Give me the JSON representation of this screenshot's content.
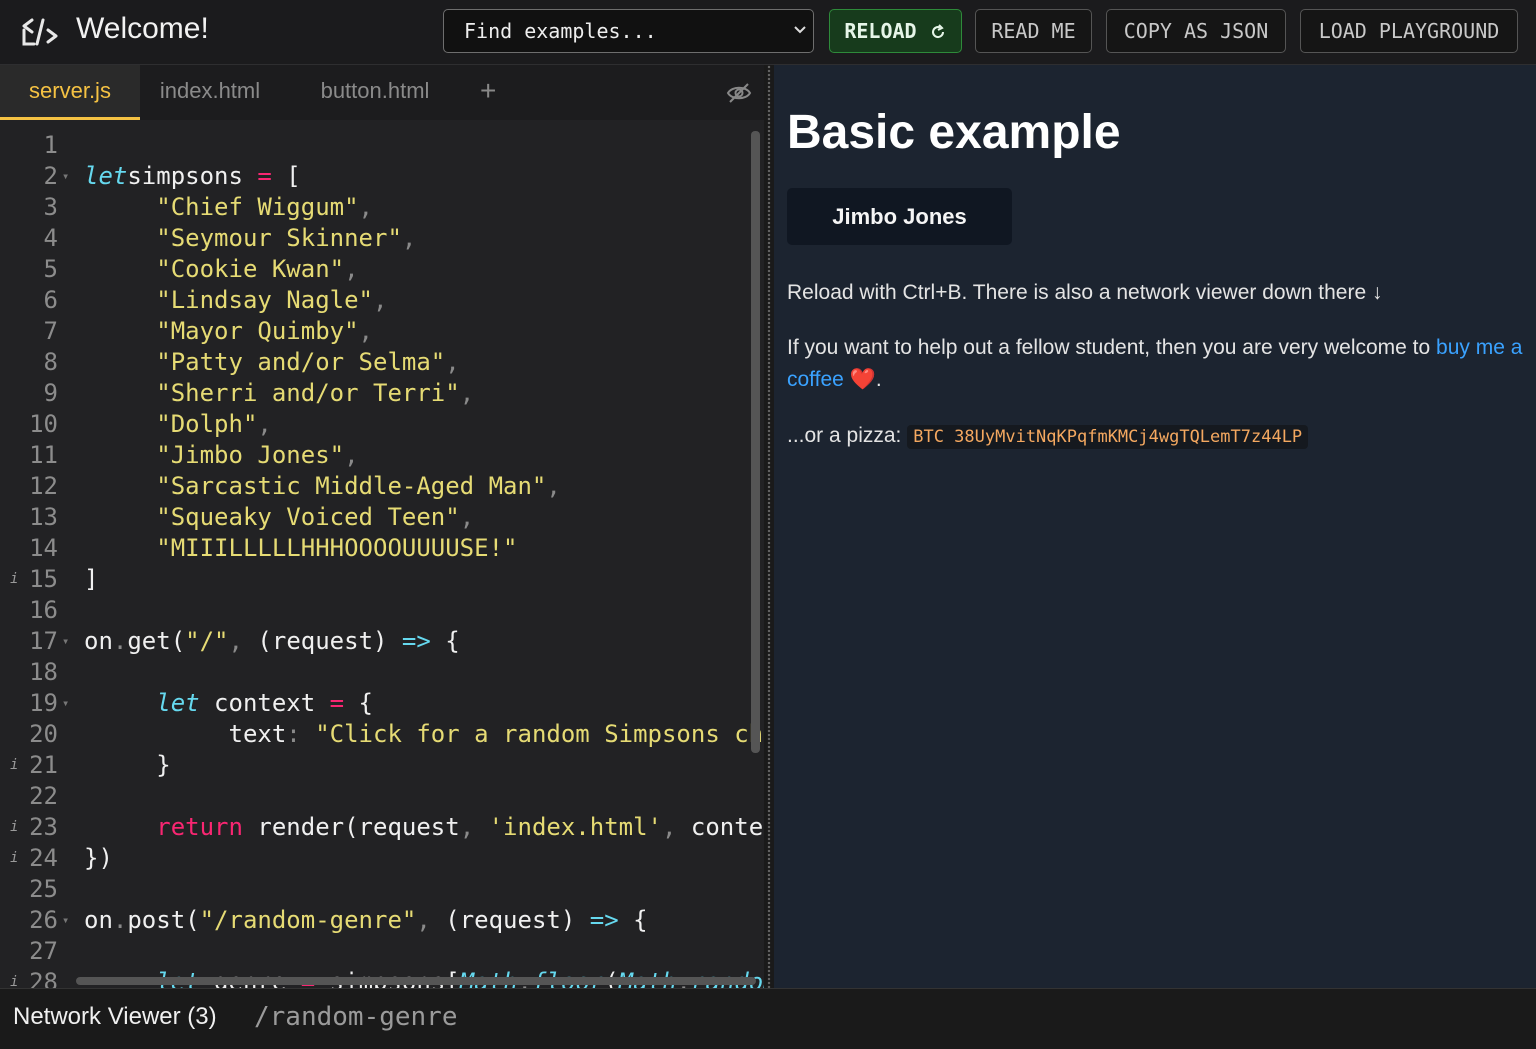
{
  "header": {
    "title": "Welcome!",
    "find_examples": "Find examples...",
    "reload": "RELOAD",
    "read_me": "READ ME",
    "copy_json": "COPY AS JSON",
    "load_playground": "LOAD PLAYGROUND"
  },
  "editor": {
    "tabs": [
      "server.js",
      "index.html",
      "button.html"
    ],
    "add_tab": "+",
    "lines": [
      {
        "n": "1",
        "tokens": []
      },
      {
        "n": "2",
        "fold": true,
        "tokens": [
          [
            "kw",
            "let"
          ],
          [
            "",
            "simpsons "
          ],
          [
            "op",
            "="
          ],
          [
            "",
            " ["
          ]
        ]
      },
      {
        "n": "3",
        "tokens": [
          [
            "",
            "     "
          ],
          [
            "str",
            "\"Chief Wiggum\""
          ],
          [
            "pn",
            ","
          ]
        ]
      },
      {
        "n": "4",
        "tokens": [
          [
            "",
            "     "
          ],
          [
            "str",
            "\"Seymour Skinner\""
          ],
          [
            "pn",
            ","
          ]
        ]
      },
      {
        "n": "5",
        "tokens": [
          [
            "",
            "     "
          ],
          [
            "str",
            "\"Cookie Kwan\""
          ],
          [
            "pn",
            ","
          ]
        ]
      },
      {
        "n": "6",
        "tokens": [
          [
            "",
            "     "
          ],
          [
            "str",
            "\"Lindsay Nagle\""
          ],
          [
            "pn",
            ","
          ]
        ]
      },
      {
        "n": "7",
        "tokens": [
          [
            "",
            "     "
          ],
          [
            "str",
            "\"Mayor Quimby\""
          ],
          [
            "pn",
            ","
          ]
        ]
      },
      {
        "n": "8",
        "tokens": [
          [
            "",
            "     "
          ],
          [
            "str",
            "\"Patty and/or Selma\""
          ],
          [
            "pn",
            ","
          ]
        ]
      },
      {
        "n": "9",
        "tokens": [
          [
            "",
            "     "
          ],
          [
            "str",
            "\"Sherri and/or Terri\""
          ],
          [
            "pn",
            ","
          ]
        ]
      },
      {
        "n": "10",
        "tokens": [
          [
            "",
            "     "
          ],
          [
            "str",
            "\"Dolph\""
          ],
          [
            "pn",
            ","
          ]
        ]
      },
      {
        "n": "11",
        "tokens": [
          [
            "",
            "     "
          ],
          [
            "str",
            "\"Jimbo Jones\""
          ],
          [
            "pn",
            ","
          ]
        ]
      },
      {
        "n": "12",
        "tokens": [
          [
            "",
            "     "
          ],
          [
            "str",
            "\"Sarcastic Middle-Aged Man\""
          ],
          [
            "pn",
            ","
          ]
        ]
      },
      {
        "n": "13",
        "tokens": [
          [
            "",
            "     "
          ],
          [
            "str",
            "\"Squeaky Voiced Teen\""
          ],
          [
            "pn",
            ","
          ]
        ]
      },
      {
        "n": "14",
        "tokens": [
          [
            "",
            "     "
          ],
          [
            "str",
            "\"MIIILLLLLHHHOOOOUUUUSE!\""
          ]
        ]
      },
      {
        "n": "15",
        "info": true,
        "tokens": [
          [
            "",
            "]"
          ]
        ]
      },
      {
        "n": "16",
        "tokens": []
      },
      {
        "n": "17",
        "fold": true,
        "tokens": [
          [
            "",
            "on"
          ],
          [
            "pn",
            "."
          ],
          [
            "",
            "get("
          ],
          [
            "str",
            "\"/\""
          ],
          [
            "pn",
            ","
          ],
          [
            "",
            " (request) "
          ],
          [
            "kw",
            "=>"
          ],
          [
            "",
            " {"
          ]
        ]
      },
      {
        "n": "18",
        "tokens": []
      },
      {
        "n": "19",
        "fold": true,
        "tokens": [
          [
            "",
            "     "
          ],
          [
            "kw",
            "let"
          ],
          [
            "",
            " context "
          ],
          [
            "op",
            "="
          ],
          [
            "",
            " {"
          ]
        ]
      },
      {
        "n": "20",
        "tokens": [
          [
            "",
            "          text"
          ],
          [
            "pn",
            ":"
          ],
          [
            "",
            " "
          ],
          [
            "str",
            "\"Click for a random Simpsons character\""
          ]
        ]
      },
      {
        "n": "21",
        "info": true,
        "tokens": [
          [
            "",
            "     }"
          ]
        ]
      },
      {
        "n": "22",
        "tokens": []
      },
      {
        "n": "23",
        "info": true,
        "tokens": [
          [
            "",
            "     "
          ],
          [
            "kr",
            "return"
          ],
          [
            "",
            " render(request"
          ],
          [
            "pn",
            ","
          ],
          [
            "",
            " "
          ],
          [
            "str",
            "'index.html'"
          ],
          [
            "pn",
            ","
          ],
          [
            "",
            " context)"
          ]
        ]
      },
      {
        "n": "24",
        "info": true,
        "tokens": [
          [
            "",
            "})"
          ]
        ]
      },
      {
        "n": "25",
        "tokens": []
      },
      {
        "n": "26",
        "fold": true,
        "tokens": [
          [
            "",
            "on"
          ],
          [
            "pn",
            "."
          ],
          [
            "",
            "post("
          ],
          [
            "str",
            "\"/random-genre\""
          ],
          [
            "pn",
            ","
          ],
          [
            "",
            " (request) "
          ],
          [
            "kw",
            "=>"
          ],
          [
            "",
            " {"
          ]
        ]
      },
      {
        "n": "27",
        "tokens": []
      },
      {
        "n": "28",
        "info": true,
        "tokens": [
          [
            "",
            "     "
          ],
          [
            "kw",
            "let"
          ],
          [
            "",
            " genre "
          ],
          [
            "op",
            "="
          ],
          [
            "",
            " simpsons["
          ],
          [
            "kw",
            "Math"
          ],
          [
            "pn",
            "."
          ],
          [
            "kw",
            "floor"
          ],
          [
            "",
            "("
          ],
          [
            "kw",
            "Math"
          ],
          [
            "pn",
            "."
          ],
          [
            "kw",
            "random"
          ],
          [
            "",
            "()"
          ]
        ]
      }
    ]
  },
  "preview": {
    "title": "Basic example",
    "button": "Jimbo Jones",
    "reload_text": "Reload with Ctrl+B. There is also a network viewer down there ↓",
    "help_text_1": "If you want to help out a fellow student, then you are very welcome to",
    "coffee_link": "buy me a coffee",
    "heart": "❤️",
    "help_text_end": ".",
    "pizza_text": "...or a pizza:",
    "btc": "BTC 38UyMvitNqKPqfmKMCj4wgTQLemT7z44LP"
  },
  "network": {
    "label": "Network Viewer (3)",
    "path": "/random-genre"
  }
}
